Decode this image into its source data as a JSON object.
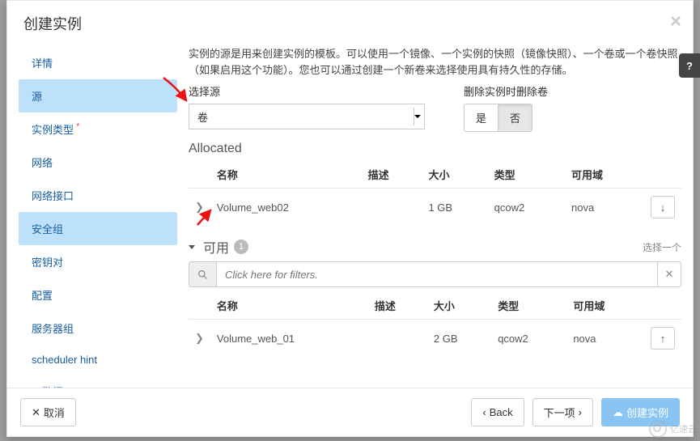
{
  "modal": {
    "title": "创建实例",
    "close": "×"
  },
  "sidebar": {
    "items": [
      {
        "label": "详情"
      },
      {
        "label": "源"
      },
      {
        "label": "实例类型"
      },
      {
        "label": "网络"
      },
      {
        "label": "网络接口"
      },
      {
        "label": "安全组"
      },
      {
        "label": "密钥对"
      },
      {
        "label": "配置"
      },
      {
        "label": "服务器组"
      },
      {
        "label": "scheduler hint"
      },
      {
        "label": "元数据"
      }
    ]
  },
  "content": {
    "intro": "实例的源是用来创建实例的模板。可以使用一个镜像、一个实例的快照（镜像快照）、一个卷或一个卷快照（如果启用这个功能）。您也可以通过创建一个新卷来选择使用具有持久性的存储。",
    "select_source_label": "选择源",
    "select_source_value": "卷",
    "delete_vol_label": "删除实例时删除卷",
    "toggle_yes": "是",
    "toggle_no": "否",
    "allocated_title": "Allocated",
    "available_title": "可用",
    "available_count": "1",
    "select_one": "选择一个",
    "filter_placeholder": "Click here for filters.",
    "columns": {
      "name": "名称",
      "desc": "描述",
      "size": "大小",
      "type": "类型",
      "zone": "可用域"
    },
    "allocated_rows": [
      {
        "name": "Volume_web02",
        "desc": "",
        "size": "1 GB",
        "type": "qcow2",
        "zone": "nova"
      }
    ],
    "available_rows": [
      {
        "name": "Volume_web_01",
        "desc": "",
        "size": "2 GB",
        "type": "qcow2",
        "zone": "nova"
      }
    ]
  },
  "footer": {
    "cancel": "取消",
    "back": "Back",
    "next": "下一项",
    "launch": "创建实例"
  },
  "watermark": "亿速云"
}
